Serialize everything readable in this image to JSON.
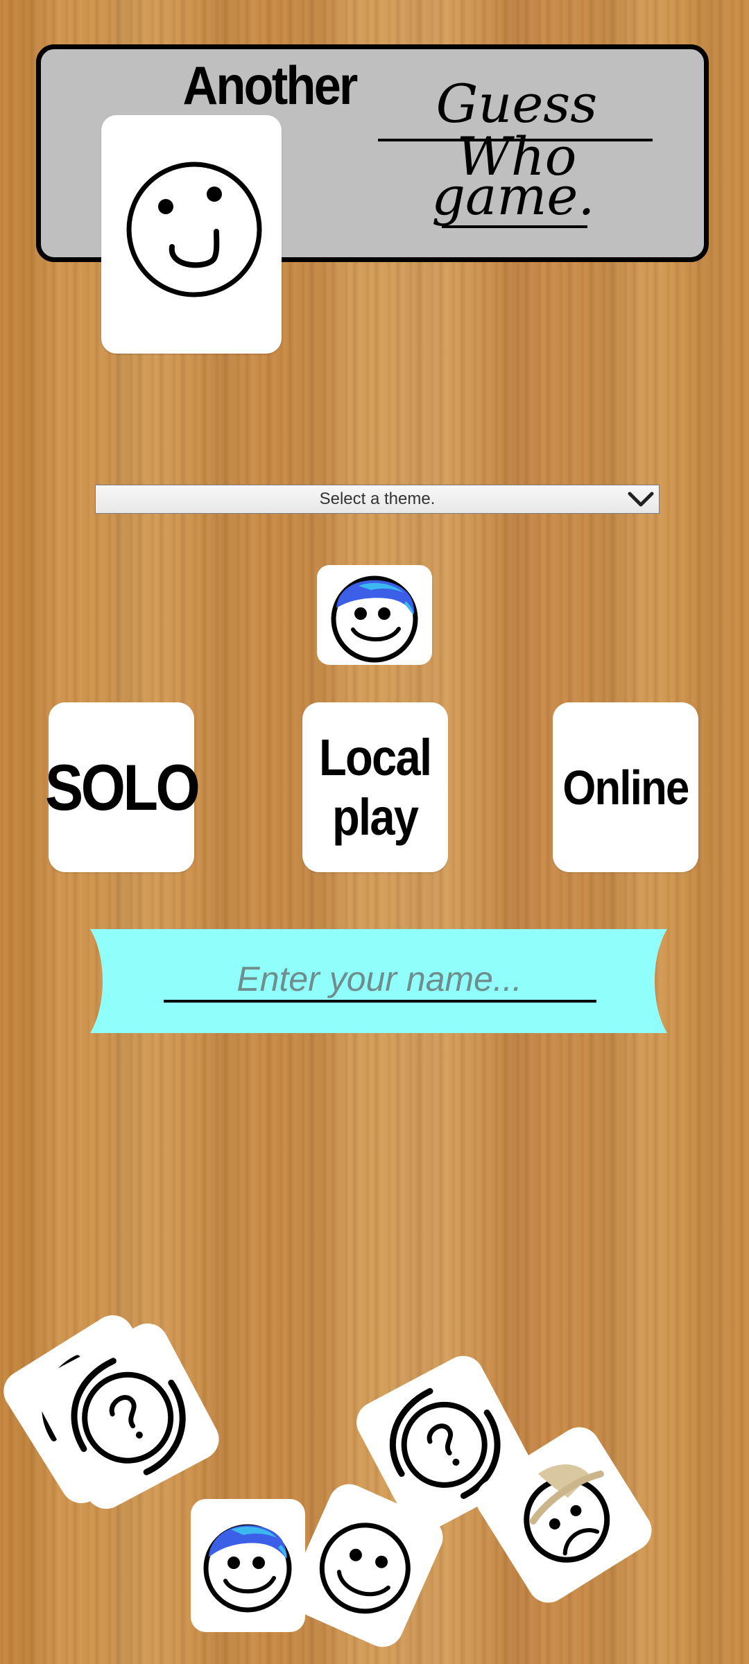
{
  "header": {
    "title_word1": "Another",
    "title_word2": "Guess Who",
    "title_word3": "game."
  },
  "theme_select": {
    "selected": "Select a theme."
  },
  "modes": {
    "solo": "SOLO",
    "local_line1": "Local",
    "local_line2": "play",
    "online": "Online"
  },
  "name_field": {
    "placeholder": "Enter your name...",
    "value": ""
  },
  "colors": {
    "ribbon": "#90fffb",
    "panel": "#bfbfbf",
    "hair_blue": "#2e64f0",
    "hair_cyan": "#3ab8ef",
    "hat": "#d9c7a0"
  },
  "decorations": {
    "scattered_cards": [
      "question-card",
      "question-card",
      "question-card",
      "blue-hair-face-card",
      "smiley-card",
      "sad-hat-face-card"
    ]
  }
}
